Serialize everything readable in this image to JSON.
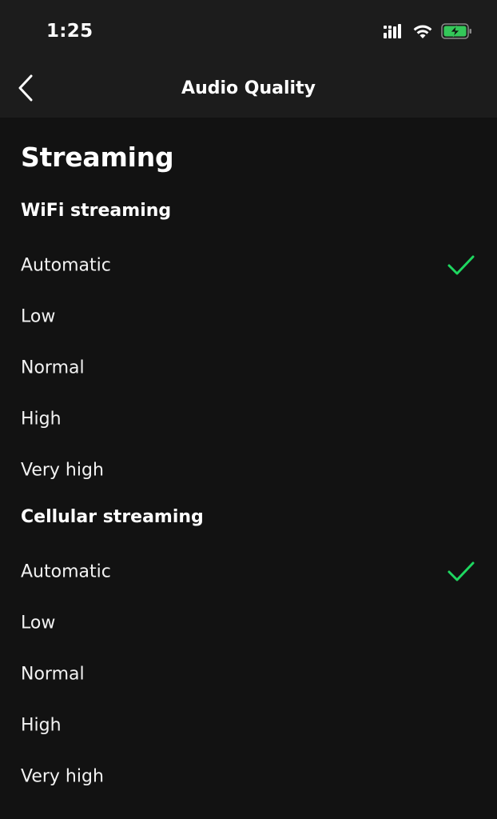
{
  "status_bar": {
    "time": "1:25",
    "icons": [
      "cellular-signal-icon",
      "wifi-icon",
      "battery-charging-icon"
    ]
  },
  "nav": {
    "title": "Audio Quality",
    "back_icon": "chevron-left-icon"
  },
  "section": {
    "title": "Streaming"
  },
  "wifi": {
    "heading": "WiFi streaming",
    "options": [
      "Automatic",
      "Low",
      "Normal",
      "High",
      "Very high"
    ],
    "selected": "Automatic"
  },
  "cellular": {
    "heading": "Cellular streaming",
    "options": [
      "Automatic",
      "Low",
      "Normal",
      "High",
      "Very high"
    ],
    "selected": "Automatic"
  },
  "colors": {
    "background": "#121212",
    "header": "#1c1c1c",
    "accent": "#1ed760"
  }
}
